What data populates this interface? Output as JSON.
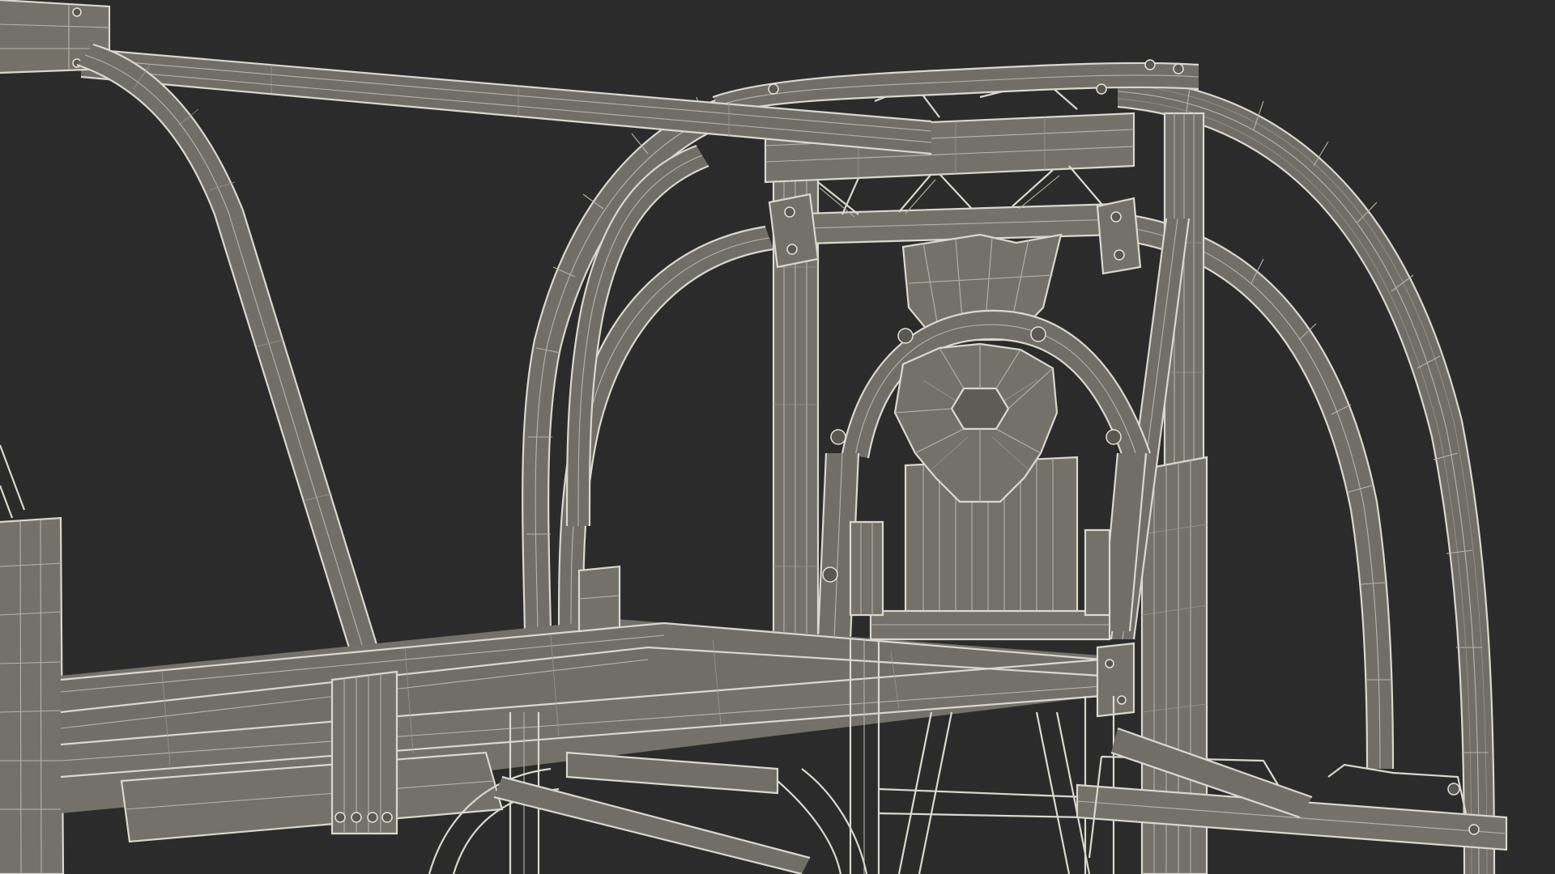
{
  "scene": {
    "description_label": "",
    "background_color": "#2b2b2b",
    "wire_color": "#d8d8cf",
    "surface_color": "#6f6f67",
    "shadow_color": "#5d5d56",
    "icons": [
      "bolt-icon"
    ]
  }
}
